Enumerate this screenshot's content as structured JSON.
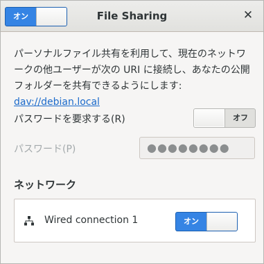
{
  "window": {
    "title": "File Sharing"
  },
  "header": {
    "master_switch": {
      "label": "オン",
      "state": "on"
    }
  },
  "description": {
    "text": "パーソナルファイル共有を利用して、現在のネットワークの他ユーザーが次の URI に接続し、あなたの公開フォルダーを共有できるようにします:",
    "link": "dav://debian.local"
  },
  "require_password": {
    "label": "パスワードを要求する(R)",
    "switch_label": "オフ",
    "state": "off"
  },
  "password": {
    "label": "パスワード(P)",
    "value": "●●●●●●●●"
  },
  "network": {
    "title": "ネットワーク",
    "connections": [
      {
        "name": "Wired connection 1",
        "switch_label": "オン",
        "state": "on"
      }
    ]
  },
  "colors": {
    "accent": "#3584e4",
    "link": "#1b6acb"
  }
}
